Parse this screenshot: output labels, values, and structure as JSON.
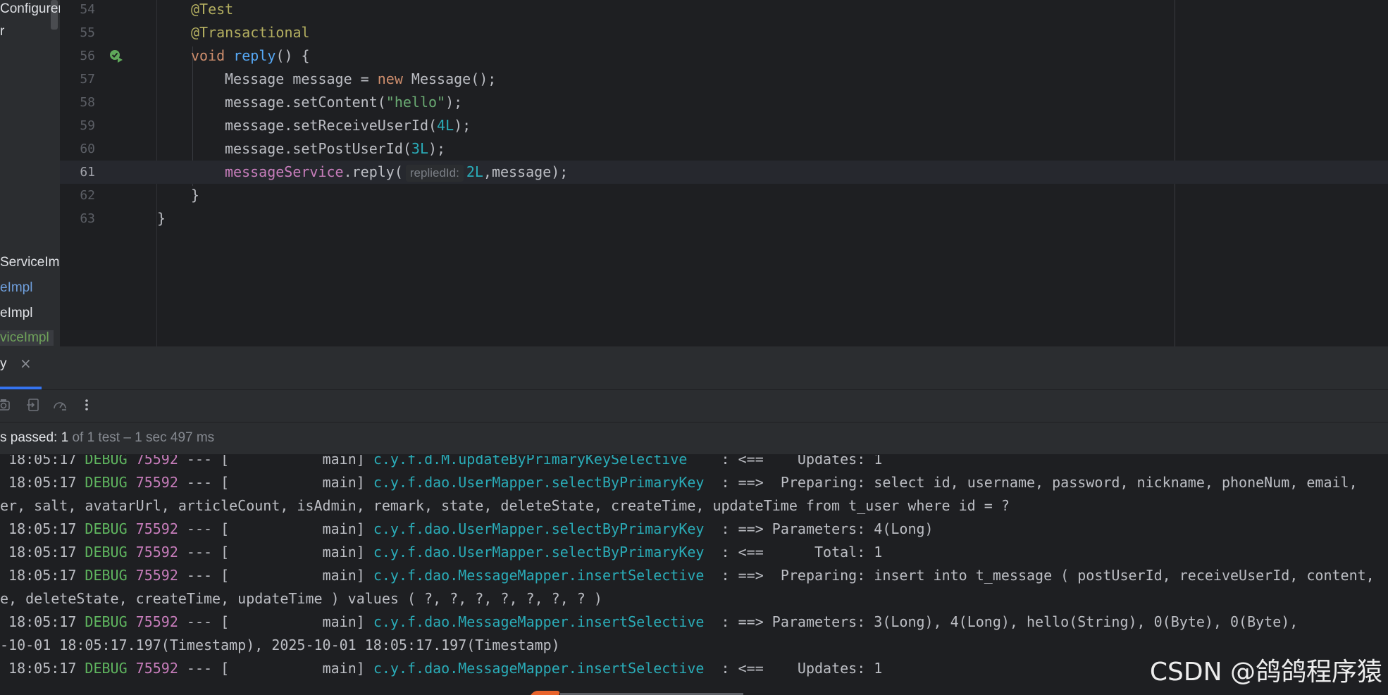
{
  "project_tree": {
    "items": [
      {
        "label": "Configurer",
        "style": "normal"
      },
      {
        "label": "r",
        "style": "normal"
      },
      {
        "label": "ServiceImp",
        "style": "normal"
      },
      {
        "label": "eImpl",
        "style": "blue"
      },
      {
        "label": "eImpl",
        "style": "normal"
      },
      {
        "label": "viceImpl",
        "style": "green"
      }
    ]
  },
  "editor": {
    "lines": [
      {
        "num": "54",
        "tokens": [
          {
            "t": "@Test",
            "c": "ann"
          }
        ],
        "indent": 1
      },
      {
        "num": "55",
        "tokens": [
          {
            "t": "@Transactional",
            "c": "ann"
          }
        ],
        "indent": 1
      },
      {
        "num": "56",
        "tokens": [
          {
            "t": "void ",
            "c": "kw"
          },
          {
            "t": "reply",
            "c": "fn"
          },
          {
            "t": "() {",
            "c": "plain"
          }
        ],
        "indent": 1,
        "run_icon": true
      },
      {
        "num": "57",
        "tokens": [
          {
            "t": "Message message = ",
            "c": "plain"
          },
          {
            "t": "new ",
            "c": "kw"
          },
          {
            "t": "Message();",
            "c": "plain"
          }
        ],
        "indent": 2
      },
      {
        "num": "58",
        "tokens": [
          {
            "t": "message.setContent(",
            "c": "plain"
          },
          {
            "t": "\"hello\"",
            "c": "str"
          },
          {
            "t": ");",
            "c": "plain"
          }
        ],
        "indent": 2
      },
      {
        "num": "59",
        "tokens": [
          {
            "t": "message.setReceiveUserId(",
            "c": "plain"
          },
          {
            "t": "4L",
            "c": "num"
          },
          {
            "t": ");",
            "c": "plain"
          }
        ],
        "indent": 2
      },
      {
        "num": "60",
        "tokens": [
          {
            "t": "message.setPostUserId(",
            "c": "plain"
          },
          {
            "t": "3L",
            "c": "num"
          },
          {
            "t": ");",
            "c": "plain"
          }
        ],
        "indent": 2
      },
      {
        "num": "61",
        "tokens": [
          {
            "t": "messageService",
            "c": "field"
          },
          {
            "t": ".reply(",
            "c": "plain"
          },
          {
            "t": "repliedId:",
            "c": "hint"
          },
          {
            "t": "2L",
            "c": "num"
          },
          {
            "t": ",message);",
            "c": "plain"
          }
        ],
        "indent": 2,
        "current": true
      },
      {
        "num": "62",
        "tokens": [
          {
            "t": "}",
            "c": "plain"
          }
        ],
        "indent": 1
      },
      {
        "num": "63",
        "tokens": [
          {
            "t": "}",
            "c": "plain"
          }
        ],
        "indent": 0
      }
    ]
  },
  "run": {
    "tab_label": "y",
    "tab_close": "×",
    "status": {
      "prefix": "s passed: ",
      "count": "1",
      "rest": " of 1 test – 1 sec 497 ms"
    }
  },
  "console": {
    "lines": [
      {
        "time": " 18:05:17 ",
        "level": "DEBUG",
        "pid": " 75592",
        "mid": " --- [           main] ",
        "logger": "c.y.f.d.M.updateByPrimaryKeySelective",
        "msg": "    : <==    Updates: 1"
      },
      {
        "time": " 18:05:17 ",
        "level": "DEBUG",
        "pid": " 75592",
        "mid": " --- [           main] ",
        "logger": "c.y.f.dao.UserMapper.selectByPrimaryKey",
        "msg": "  : ==>  Preparing: select id, username, password, nickname, phoneNum, email,"
      },
      {
        "plain": "er, salt, avatarUrl, articleCount, isAdmin, remark, state, deleteState, createTime, updateTime from t_user where id = ?"
      },
      {
        "time": " 18:05:17 ",
        "level": "DEBUG",
        "pid": " 75592",
        "mid": " --- [           main] ",
        "logger": "c.y.f.dao.UserMapper.selectByPrimaryKey",
        "msg": "  : ==> Parameters: 4(Long)"
      },
      {
        "time": " 18:05:17 ",
        "level": "DEBUG",
        "pid": " 75592",
        "mid": " --- [           main] ",
        "logger": "c.y.f.dao.UserMapper.selectByPrimaryKey",
        "msg": "  : <==      Total: 1"
      },
      {
        "time": " 18:05:17 ",
        "level": "DEBUG",
        "pid": " 75592",
        "mid": " --- [           main] ",
        "logger": "c.y.f.dao.MessageMapper.insertSelective",
        "msg": "  : ==>  Preparing: insert into t_message ( postUserId, receiveUserId, content,"
      },
      {
        "plain": "e, deleteState, createTime, updateTime ) values ( ?, ?, ?, ?, ?, ?, ? )"
      },
      {
        "time": " 18:05:17 ",
        "level": "DEBUG",
        "pid": " 75592",
        "mid": " --- [           main] ",
        "logger": "c.y.f.dao.MessageMapper.insertSelective",
        "msg": "  : ==> Parameters: 3(Long), 4(Long), hello(String), 0(Byte), 0(Byte),"
      },
      {
        "plain": "-10-01 18:05:17.197(Timestamp), 2025-10-01 18:05:17.197(Timestamp)"
      },
      {
        "time": " 18:05:17 ",
        "level": "DEBUG",
        "pid": " 75592",
        "mid": " --- [           main] ",
        "logger": "c.y.f.dao.MessageMapper.insertSelective",
        "msg": "  : <==    Updates: 1"
      }
    ]
  },
  "watermark": "CSDN @鸽鸽程序猿",
  "colors": {
    "editor_bg": "#1e1f22",
    "panel_bg": "#2b2d30",
    "accent": "#3574f0",
    "annotation": "#b3ae60",
    "keyword": "#cf8e6d",
    "string": "#6aab73",
    "number": "#2aacb8",
    "field": "#c77dbb",
    "debug": "#5fb55f"
  },
  "toolbar_icons": [
    "camera-icon",
    "import-icon",
    "speedometer-icon",
    "more-vertical-icon"
  ]
}
